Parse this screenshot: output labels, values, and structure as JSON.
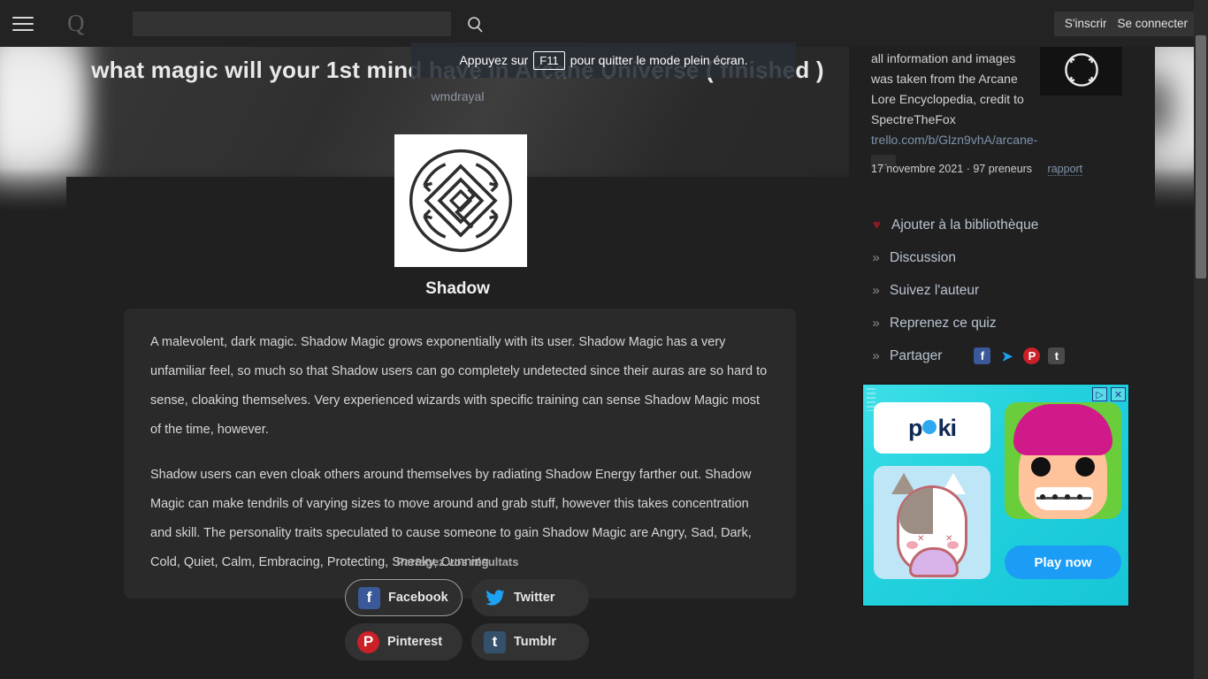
{
  "topnav": {
    "menu_icon": "hamburger-icon",
    "brand": "Q",
    "search_placeholder": "",
    "search_value": "",
    "search_icon": "search-icon",
    "signup_label": "S'inscrire",
    "login_label": "Se connecter"
  },
  "fullscreen_toast": {
    "before": "Appuyez sur",
    "key": "F11",
    "after": "pour quitter le mode plein écran."
  },
  "quiz": {
    "title": "what magic will your 1st mind have in Arcane Universe ( finished )",
    "author": "wmdrayal"
  },
  "result": {
    "image_name": "shadow-magic-sigil",
    "name": "Shadow",
    "paragraphs": [
      "A malevolent, dark magic. Shadow Magic grows exponentially with its user. Shadow Magic has a very unfamiliar feel, so much so that Shadow users can go completely undetected since their auras are so hard to sense, cloaking themselves. Very experienced wizards with specific training can sense Shadow Magic most of the time, however.",
      "Shadow users can even cloak others around themselves by radiating Shadow Energy farther out. Shadow Magic can make tendrils of varying sizes to move around and grab stuff, however this takes concentration and skill. The personality traits speculated to cause someone to gain Shadow Magic are Angry, Sad, Dark, Cold, Quiet, Calm, Embracing, Protecting, Sneaky, Cunning."
    ]
  },
  "share": {
    "heading": "Partagez vos résultats",
    "buttons": [
      {
        "label": "Facebook",
        "glyph": "f",
        "color": "#3b5998",
        "icon": "facebook-icon",
        "focused": true
      },
      {
        "label": "Twitter",
        "glyph": "t",
        "color": "#1da1f2",
        "icon": "twitter-icon",
        "focused": false
      },
      {
        "label": "Pinterest",
        "glyph": "P",
        "color": "#cb2027",
        "icon": "pinterest-icon",
        "focused": false
      },
      {
        "label": "Tumblr",
        "glyph": "t",
        "color": "#35506b",
        "icon": "tumblr-icon",
        "focused": false
      }
    ]
  },
  "sidebar": {
    "description": "all information and images was taken from the Arcane Lore Encyclopedia, credit to SpectreTheFox",
    "link": "trello.com/b/Glzn9vhA/arcane-",
    "more_label": "…",
    "thumbnail_name": "arcane-circle-thumbnail",
    "meta": "17 novembre 2021 · 97 preneurs",
    "report_label": "rapport",
    "links": [
      {
        "label": "Ajouter à la bibliothèque",
        "icon": "heart-icon",
        "bullet": "♥"
      },
      {
        "label": "Discussion",
        "icon": "chevron-icon",
        "bullet": "»"
      },
      {
        "label": "Suivez l'auteur",
        "icon": "chevron-icon",
        "bullet": "»"
      },
      {
        "label": "Reprenez ce quiz",
        "icon": "chevron-icon",
        "bullet": "»"
      },
      {
        "label": "Partager",
        "icon": "chevron-icon",
        "bullet": "»"
      }
    ],
    "mini_share": [
      {
        "glyph": "f",
        "color": "#3b5998",
        "icon": "facebook-icon"
      },
      {
        "glyph": "t",
        "color": "#1da1f2",
        "icon": "twitter-icon"
      },
      {
        "glyph": "P",
        "color": "#cb2027",
        "icon": "pinterest-icon"
      },
      {
        "glyph": "t",
        "color": "#4a4a4a",
        "icon": "tumblr-icon"
      }
    ]
  },
  "ad": {
    "brand": "poki",
    "cta_label": "Play now",
    "adchoices_glyph": "▷",
    "close_glyph": "✕"
  },
  "colors": {
    "page_bg": "#202020",
    "nav_bg": "#232323",
    "card_bg": "#2a2a2a",
    "link_blue": "#7d93ad",
    "heart_red": "#8e1b22",
    "ad_cyan": "#23d2de"
  }
}
